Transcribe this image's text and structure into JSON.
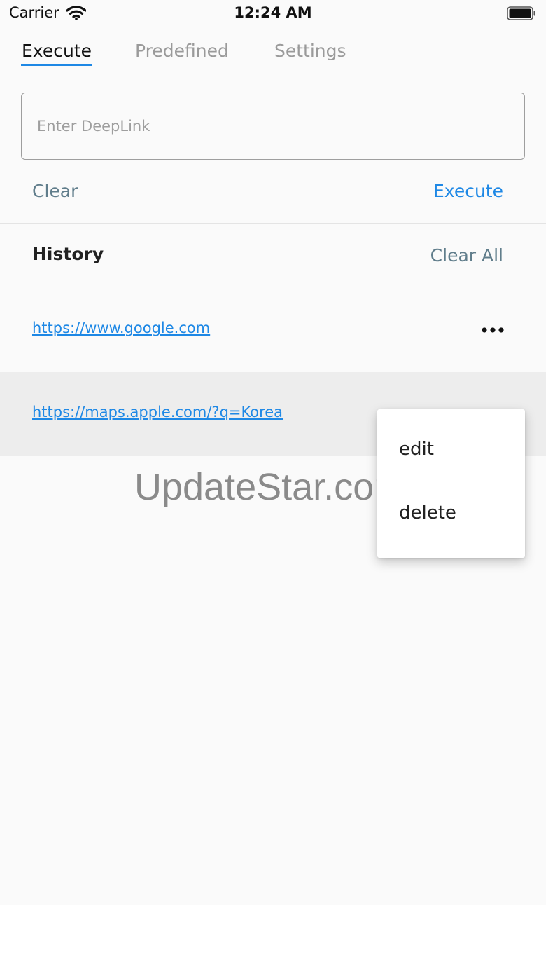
{
  "status_bar": {
    "carrier": "Carrier",
    "time": "12:24 AM"
  },
  "tabs": [
    {
      "label": "Execute",
      "active": true
    },
    {
      "label": "Predefined",
      "active": false
    },
    {
      "label": "Settings",
      "active": false
    }
  ],
  "deeplink": {
    "placeholder": "Enter DeepLink",
    "value": ""
  },
  "actions": {
    "clear_label": "Clear",
    "execute_label": "Execute"
  },
  "history": {
    "title": "History",
    "clear_all_label": "Clear All",
    "items": [
      {
        "url": "https://www.google.com"
      },
      {
        "url": "https://maps.apple.com/?q=Korea"
      }
    ]
  },
  "popup_menu": {
    "items": [
      {
        "label": "edit"
      },
      {
        "label": "delete"
      }
    ]
  },
  "watermark": "UpdateStar.com",
  "colors": {
    "accent": "#1e88e5",
    "secondary": "#607d8b",
    "inactive_tab": "#9a9a9a",
    "selected_row": "#ededed"
  },
  "icons": {
    "wifi": "wifi-icon",
    "battery": "battery-icon",
    "more": "more-horizontal-icon"
  }
}
